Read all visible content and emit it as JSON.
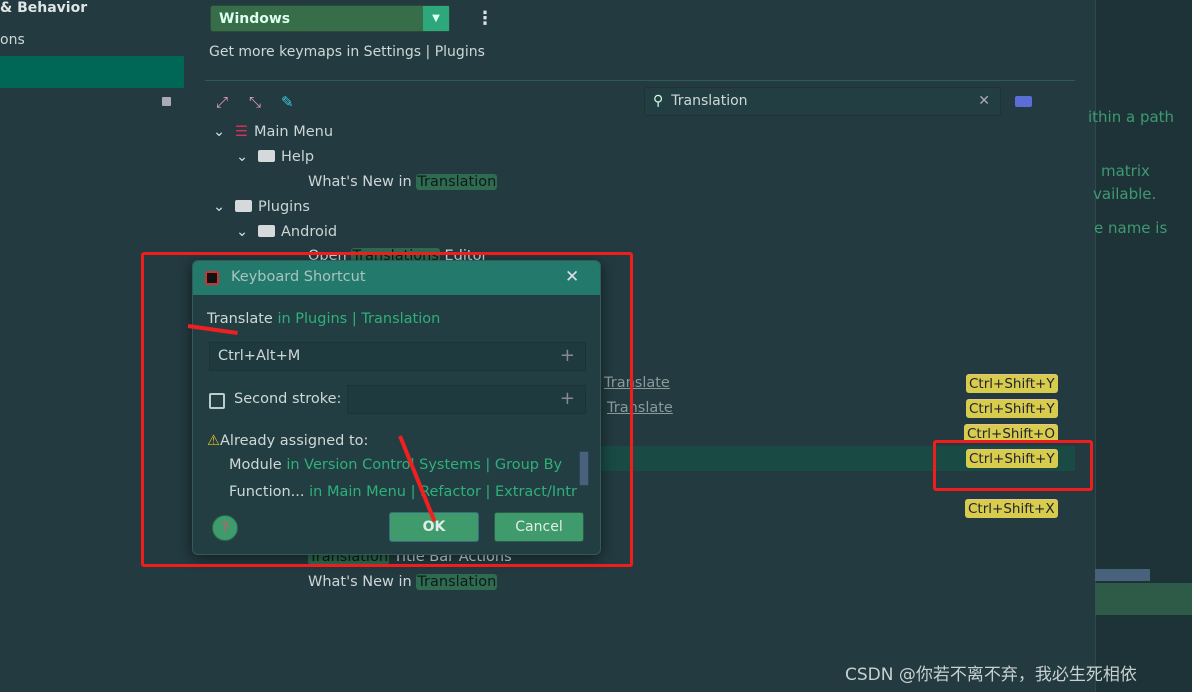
{
  "sidebar": {
    "title": "& Behavior",
    "item": "ons"
  },
  "keymap": {
    "selected": "Windows",
    "more_link": "Get more keymaps in Settings | Plugins"
  },
  "search": {
    "value": "Translation"
  },
  "tree": [
    {
      "label": "Main Menu"
    },
    {
      "label": "Help"
    },
    {
      "prefix": "What's New in ",
      "match": "Translation"
    },
    {
      "label": "Plugins"
    },
    {
      "label": "Android"
    },
    {
      "prefix": "Open ",
      "match": "Translations",
      "suffix": " Editor"
    },
    {
      "match": "Translation",
      "suffix": " Title Bar Actions"
    },
    {
      "prefix": "What's New in ",
      "match": "Translation"
    }
  ],
  "partial_links": [
    "Translate",
    "Translate"
  ],
  "shortcuts": [
    "Ctrl+Shift+Y",
    "Ctrl+Shift+Y",
    "Ctrl+Shift+O",
    "Ctrl+Shift+Y",
    "Ctrl+Shift+X"
  ],
  "right_panel": [
    "ithin a path",
    "matrix",
    "vailable.",
    "e name is"
  ],
  "dialog": {
    "title": "Keyboard Shortcut",
    "action": "Translate",
    "action_path": " in Plugins | Translation",
    "first_stroke": "Ctrl+Alt+M",
    "second_stroke_label": "Second stroke:",
    "second_stroke_checked": false,
    "warning": "Already assigned to:",
    "conflicts": [
      {
        "name": "Module",
        "path": " in Version Control Systems | Group By"
      },
      {
        "name": "Function...",
        "path": " in Main Menu | Refactor | Extract/Intr"
      }
    ],
    "ok": "OK",
    "cancel": "Cancel"
  },
  "watermark": "CSDN @你若不离不弃，我必生死相依",
  "colors": {
    "accent": "#237a6c",
    "highlight": "#2f6b52",
    "shortcut": "#d8cc4c",
    "annotation": "#f01d1d"
  }
}
